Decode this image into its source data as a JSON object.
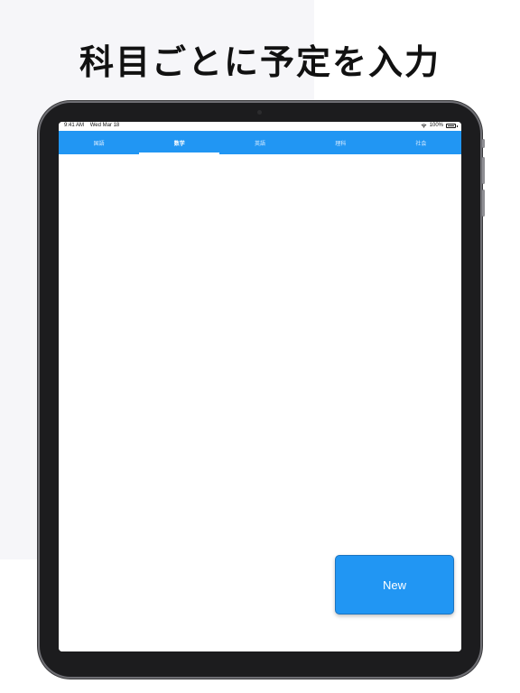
{
  "headline": "科目ごとに予定を入力",
  "status_bar": {
    "time": "9:41 AM",
    "date": "Wed Mar 18",
    "battery": "100%"
  },
  "tabs": [
    {
      "label": "国語",
      "active": false
    },
    {
      "label": "数学",
      "active": true
    },
    {
      "label": "英語",
      "active": false
    },
    {
      "label": "理科",
      "active": false
    },
    {
      "label": "社会",
      "active": false
    }
  ],
  "new_button": {
    "label": "New"
  },
  "colors": {
    "accent": "#2196f3",
    "device_frame": "#1c1c1e",
    "background_panel": "#f6f6f9"
  },
  "icons": {
    "wifi": "wifi-icon",
    "battery": "battery-icon"
  }
}
